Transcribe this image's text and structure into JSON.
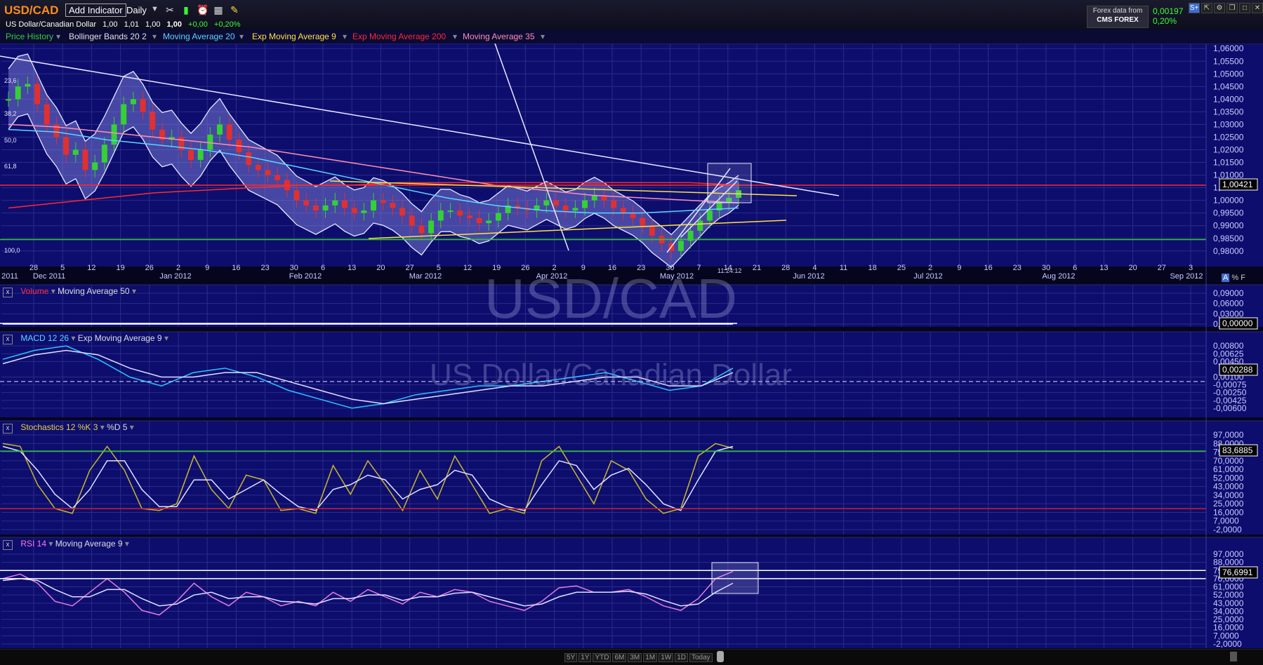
{
  "header": {
    "symbol": "USD/CAD",
    "add_indicator": "Add Indicator",
    "interval": "Daily",
    "instrument_name": "US Dollar/Canadian Dollar",
    "open": "1,00",
    "high": "1,01",
    "low": "1,00",
    "close": "1,00",
    "change": "+0,00",
    "change_pct": "+0,20%",
    "provider_label": "Forex data from",
    "provider_name": "CMS FOREX",
    "last_change": "0,00197",
    "last_change_pct": "0,20%"
  },
  "legend": {
    "items": [
      {
        "label": "Price History",
        "color": "#34d134"
      },
      {
        "label": "Bollinger Bands 20 2",
        "color": "#e0e0e0"
      },
      {
        "label": "Moving Average 20",
        "color": "#5ad5ff"
      },
      {
        "label": "Exp Moving Average 9",
        "color": "#ffe23c"
      },
      {
        "label": "Exp Moving Average 200",
        "color": "#ff2a2a"
      },
      {
        "label": "Moving Average 35",
        "color": "#ff8fb0"
      }
    ]
  },
  "watermark": {
    "symbol": "USD/CAD",
    "name": "US Dollar/Canadian Dollar"
  },
  "panels": {
    "volume": {
      "title": "Volume",
      "indicator": "Moving Average 50"
    },
    "macd": {
      "title": "MACD 12 26",
      "indicator": "Exp Moving Average 9"
    },
    "stoch": {
      "title": "Stochastics 12 %K 3",
      "indicator": "%D 5"
    },
    "rsi": {
      "title": "RSI 14",
      "indicator": "Moving Average 9"
    }
  },
  "time_axis": {
    "ticks": [
      "28",
      "5",
      "12",
      "19",
      "26",
      "2",
      "9",
      "16",
      "23",
      "30",
      "6",
      "13",
      "20",
      "27",
      "5",
      "12",
      "19",
      "26",
      "2",
      "9",
      "16",
      "23",
      "30",
      "7",
      "14",
      "21",
      "28",
      "4",
      "11",
      "18",
      "25",
      "2",
      "9",
      "16",
      "23",
      "30",
      "6",
      "13",
      "20",
      "27",
      "3"
    ],
    "months": [
      "2011",
      "Dec 2011",
      "Jan 2012",
      "Feb 2012",
      "Mar 2012",
      "Apr 2012",
      "May 2012",
      "Jun 2012",
      "Jul 2012",
      "Aug 2012",
      "Sep 2012"
    ],
    "timestamp": "11:24:12"
  },
  "fib_labels": [
    "23,6",
    "38,2",
    "50,0",
    "61,8",
    "100,0"
  ],
  "axis_toggle": [
    "A",
    "%",
    "F"
  ],
  "range_buttons": [
    "5Y",
    "1Y",
    "YTD",
    "6M",
    "3M",
    "1M",
    "1W",
    "1D",
    "Today"
  ],
  "chart_data": [
    {
      "type": "candlestick",
      "title": "USD/CAD",
      "ylim": [
        0.978,
        1.062
      ],
      "y_ticks": [
        "1,06000",
        "1,05500",
        "1,05000",
        "1,04500",
        "1,04000",
        "1,03500",
        "1,03000",
        "1,02500",
        "1,02000",
        "1,01500",
        "1,01000",
        "1,00500",
        "1,00000",
        "0,99500",
        "0,99000",
        "0,98500",
        "0,98000"
      ],
      "last_value": "1,00421",
      "series": [
        {
          "name": "Price History",
          "values": [
            1.04,
            1.045,
            1.046,
            1.038,
            1.03,
            1.025,
            1.018,
            1.02,
            1.012,
            1.015,
            1.022,
            1.03,
            1.038,
            1.04,
            1.035,
            1.028,
            1.024,
            1.025,
            1.02,
            1.016,
            1.02,
            1.026,
            1.03,
            1.024,
            1.019,
            1.014,
            1.012,
            1.01,
            1.008,
            1.004,
            1.0,
            0.998,
            0.996,
            0.998,
            1.0,
            0.997,
            0.995,
            0.996,
            1.0,
            0.999,
            0.997,
            0.994,
            0.99,
            0.987,
            0.992,
            0.996,
            0.996,
            0.994,
            0.993,
            0.991,
            0.992,
            0.995,
            0.998,
            0.997,
            0.996,
            0.998,
            1.0,
            0.998,
            0.996,
            0.997,
            1.0,
            1.002,
            1.0,
            0.997,
            0.995,
            0.993,
            0.99,
            0.986,
            0.983,
            0.98,
            0.984,
            0.988,
            0.992,
            0.996,
            0.999,
            1.001,
            1.004
          ]
        },
        {
          "name": "Exp Moving Average 200",
          "values": [
            0.997,
            0.999,
            1.001,
            1.003,
            1.004,
            1.005,
            1.006,
            1.006,
            1.007,
            1.007,
            1.007,
            1.007,
            1.007,
            1.007,
            1.007,
            1.006
          ]
        },
        {
          "name": "Moving Average 35",
          "values": [
            1.03,
            1.029,
            1.027,
            1.025,
            1.023,
            1.021,
            1.018,
            1.015,
            1.012,
            1.009,
            1.006,
            1.004,
            1.002,
            1.001,
            1.0,
            0.999
          ]
        },
        {
          "name": "Moving Average 20",
          "values": [
            1.028,
            1.027,
            1.024,
            1.022,
            1.02,
            1.017,
            1.013,
            1.009,
            1.005,
            1.001,
            0.998,
            0.996,
            0.995,
            0.995,
            0.996,
            0.997
          ]
        }
      ],
      "horizontal_lines": [
        {
          "value": 1.006,
          "color": "#ff2a2a"
        },
        {
          "value": 0.9845,
          "color": "#2ad02a"
        }
      ]
    },
    {
      "type": "line",
      "title": "Volume",
      "y_ticks": [
        "0,09000",
        "0,06000",
        "0,03000",
        "0,00000"
      ],
      "last_value": "0,00000",
      "series": [
        {
          "name": "Volume",
          "values": [
            0,
            0
          ]
        }
      ]
    },
    {
      "type": "line",
      "title": "MACD 12 26",
      "y_ticks": [
        "0,00800",
        "0,00625",
        "0,00450",
        "0,00100",
        "-0,00075",
        "-0,00250",
        "-0,00425",
        "-0,00600"
      ],
      "last_value": "0,00288",
      "series": [
        {
          "name": "MACD",
          "values": [
            0.005,
            0.007,
            0.008,
            0.005,
            0.001,
            -0.001,
            0.002,
            0.003,
            0.001,
            -0.002,
            -0.004,
            -0.006,
            -0.005,
            -0.003,
            -0.002,
            -0.001,
            -0.001,
            0.0,
            0.001,
            0.002,
            0.0,
            -0.002,
            -0.001,
            0.003
          ]
        },
        {
          "name": "Exp Moving Average 9",
          "values": [
            0.004,
            0.006,
            0.007,
            0.006,
            0.003,
            0.001,
            0.001,
            0.002,
            0.002,
            0.0,
            -0.002,
            -0.004,
            -0.005,
            -0.004,
            -0.003,
            -0.002,
            -0.001,
            -0.001,
            0.0,
            0.001,
            0.001,
            -0.001,
            -0.001,
            0.002
          ]
        }
      ]
    },
    {
      "type": "line",
      "title": "Stochastics 12 %K 3",
      "y_ticks": [
        "97,0000",
        "88,0000",
        "79,0000",
        "70,0000",
        "61,0000",
        "52,0000",
        "43,0000",
        "34,0000",
        "25,0000",
        "16,0000",
        "7,0000",
        "-2,0000"
      ],
      "last_value": "83,6885",
      "series": [
        {
          "name": "%K",
          "values": [
            88,
            85,
            45,
            20,
            15,
            60,
            85,
            60,
            20,
            18,
            25,
            75,
            40,
            20,
            55,
            50,
            18,
            20,
            15,
            65,
            35,
            70,
            45,
            18,
            60,
            30,
            75,
            45,
            15,
            20,
            15,
            70,
            85,
            55,
            25,
            70,
            60,
            30,
            15,
            20,
            75,
            88,
            83
          ]
        },
        {
          "name": "%D",
          "values": [
            85,
            80,
            60,
            35,
            20,
            40,
            70,
            70,
            40,
            22,
            22,
            50,
            50,
            30,
            40,
            50,
            35,
            22,
            18,
            40,
            45,
            55,
            50,
            30,
            40,
            45,
            60,
            55,
            30,
            22,
            18,
            45,
            70,
            65,
            40,
            55,
            62,
            45,
            25,
            18,
            50,
            80,
            85
          ]
        }
      ]
    },
    {
      "type": "line",
      "title": "RSI 14",
      "y_ticks": [
        "97,0000",
        "88,0000",
        "79,0000",
        "70,0000",
        "61,0000",
        "52,0000",
        "43,0000",
        "34,0000",
        "25,0000",
        "16,0000",
        "7,0000",
        "-2,0000"
      ],
      "last_value": "76,6991",
      "series": [
        {
          "name": "RSI",
          "values": [
            70,
            75,
            65,
            45,
            40,
            55,
            70,
            55,
            35,
            30,
            45,
            65,
            50,
            40,
            55,
            50,
            40,
            45,
            40,
            55,
            45,
            58,
            50,
            42,
            55,
            50,
            58,
            55,
            45,
            40,
            35,
            45,
            60,
            62,
            55,
            55,
            58,
            50,
            40,
            35,
            48,
            70,
            78
          ]
        },
        {
          "name": "Moving Average 9",
          "values": [
            68,
            70,
            68,
            58,
            50,
            50,
            58,
            58,
            48,
            40,
            42,
            52,
            55,
            48,
            50,
            50,
            45,
            44,
            42,
            48,
            48,
            52,
            52,
            46,
            50,
            50,
            54,
            55,
            50,
            45,
            40,
            42,
            50,
            55,
            55,
            55,
            56,
            53,
            46,
            40,
            42,
            55,
            65
          ]
        }
      ],
      "horizontal_lines": [
        {
          "value": 79
        },
        {
          "value": 70
        }
      ]
    }
  ]
}
